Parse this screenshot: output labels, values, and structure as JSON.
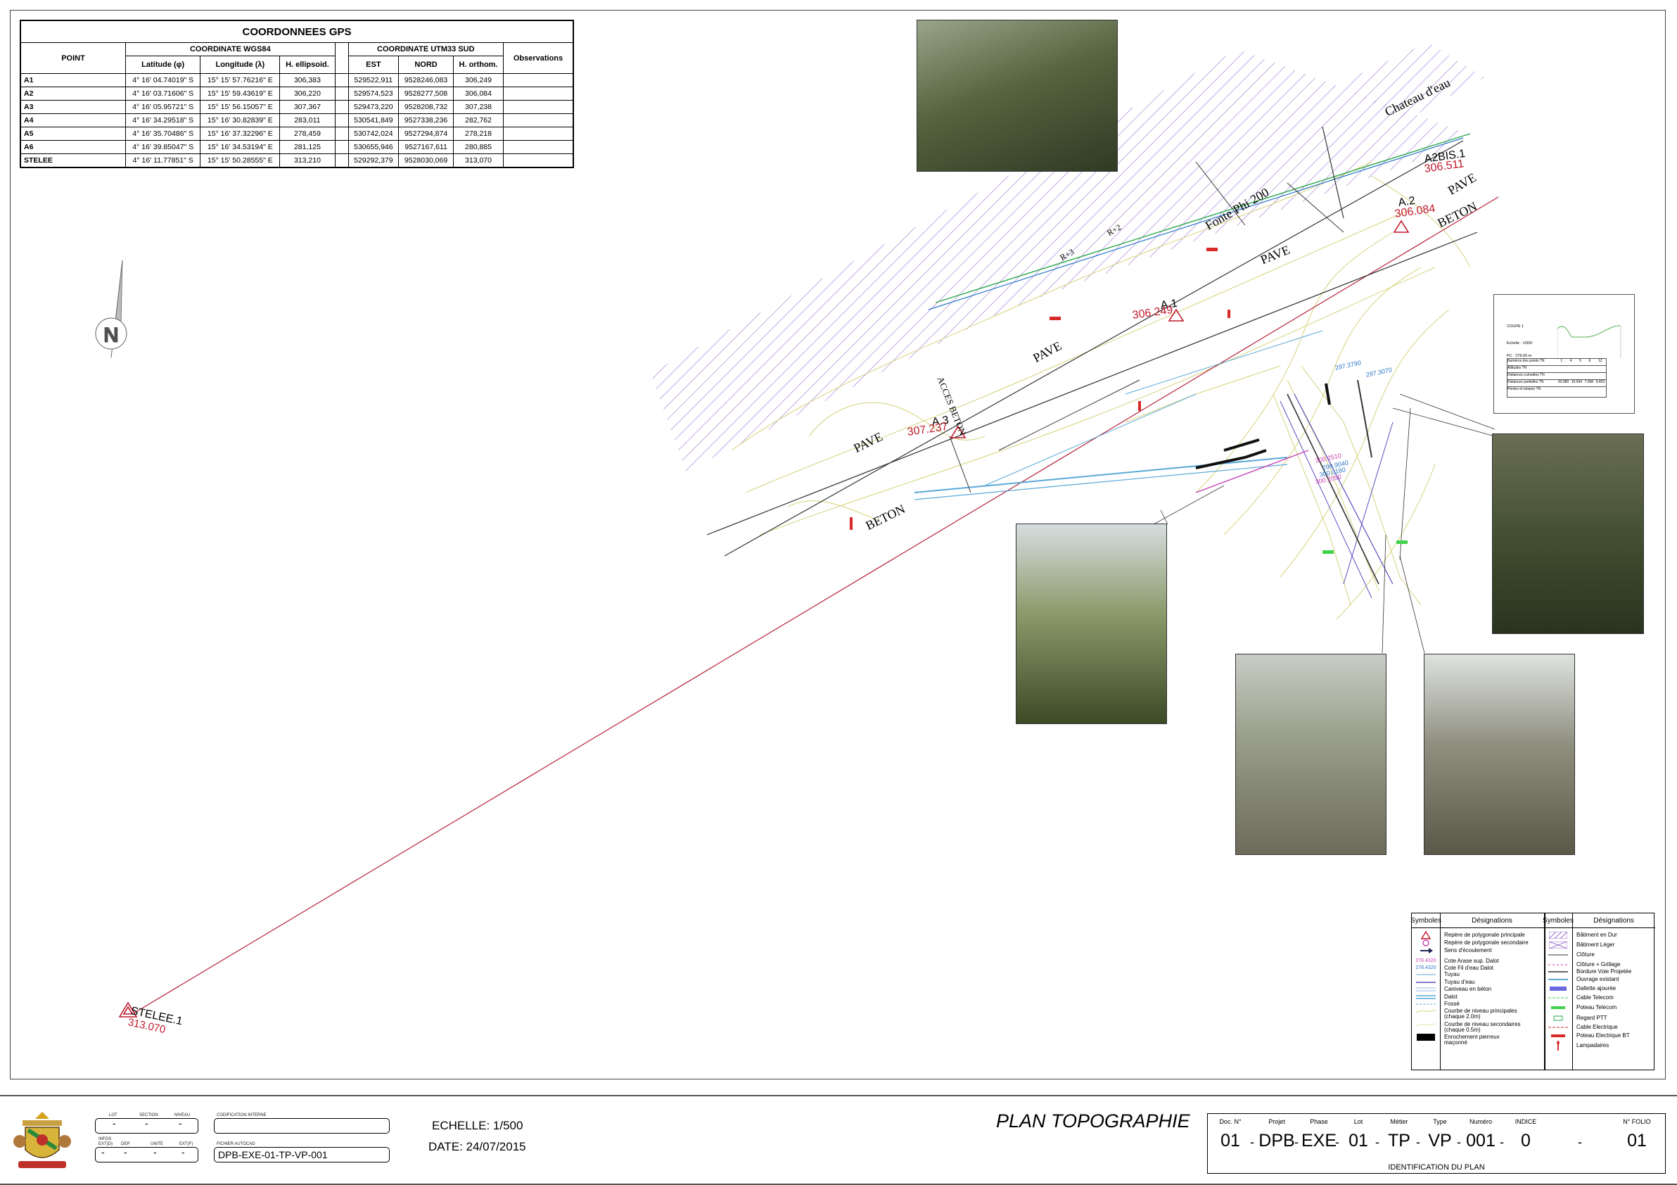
{
  "gps_table": {
    "title": "COORDONNEES GPS",
    "col_point": "POINT",
    "group_wgs": "COORDINATE WGS84",
    "group_utm": "COORDINATE UTM33 SUD",
    "col_obs": "Observations",
    "sub_lat": "Latitude (φ)",
    "sub_lon": "Longitude (λ)",
    "sub_hel": "H. ellipsoid.",
    "sub_est": "EST",
    "sub_nord": "NORD",
    "sub_hor": "H. orthom.",
    "rows": [
      {
        "point": "A1",
        "lat": "4° 16' 04.74019\" S",
        "lon": "15° 15' 57.76216\" E",
        "hel": "306,383",
        "est": "529522,911",
        "nord": "9528246,083",
        "hor": "306,249"
      },
      {
        "point": "A2",
        "lat": "4° 16' 03.71606\" S",
        "lon": "15° 15' 59.43619\" E",
        "hel": "306,220",
        "est": "529574,523",
        "nord": "9528277,508",
        "hor": "306,084"
      },
      {
        "point": "A3",
        "lat": "4° 16' 05.95721\" S",
        "lon": "15° 15' 56.15057\" E",
        "hel": "307,367",
        "est": "529473,220",
        "nord": "9528208,732",
        "hor": "307,238"
      },
      {
        "point": "A4",
        "lat": "4° 16' 34.29518\" S",
        "lon": "15° 16' 30.82839\" E",
        "hel": "283,011",
        "est": "530541,849",
        "nord": "9527338,236",
        "hor": "282,762"
      },
      {
        "point": "A5",
        "lat": "4° 16' 35.70486\" S",
        "lon": "15° 16' 37.32296\" E",
        "hel": "278,459",
        "est": "530742,024",
        "nord": "9527294,874",
        "hor": "278,218"
      },
      {
        "point": "A6",
        "lat": "4° 16' 39.85047\" S",
        "lon": "15° 16' 34.53194\" E",
        "hel": "281,125",
        "est": "530655,946",
        "nord": "9527167,611",
        "hor": "280,885"
      },
      {
        "point": "STELEE",
        "lat": "4° 16' 11.77851\" S",
        "lon": "15° 15' 50.28555\" E",
        "hel": "313,210",
        "est": "529292,379",
        "nord": "9528030,069",
        "hor": "313,070"
      }
    ]
  },
  "north": {
    "letter": "N"
  },
  "map_labels": {
    "chateau": "Chateau d'eau",
    "fonte": "Fonte Phi 200",
    "r3": "R+3",
    "r2": "R+2",
    "acces": "ACCES BETON",
    "pave": "PAVE",
    "beton": "BETON"
  },
  "points": {
    "a2bis_name": "A2BIS.1",
    "a2bis_elev": "306.511",
    "a2_name": "A.2",
    "a2_elev": "306.084",
    "a1_name": "A.1",
    "a1_elev": "306.249",
    "a3_name": "A.3",
    "a3_elev": "307.237",
    "stelee_name": "STELEE.1",
    "stelee_elev": "313.070",
    "lev1": "297.3790",
    "lev2": "297.3070",
    "lev3": "300.2510",
    "lev4": "299.9040",
    "lev5": "300.0180",
    "lev6": "300.2050"
  },
  "section": {
    "title": "COUPE 1",
    "scale": "Echelle : 1/500",
    "pc": "PC : 278.00 m",
    "row1": "Numéros des points TN",
    "row2": "Altitudes TN",
    "row3": "Distances cumulées TN",
    "row4": "Distances partielles TN",
    "row5": "Pentes et rampes TN",
    "v1": [
      "1",
      "4",
      "5",
      "6",
      "12"
    ],
    "v4": [
      "30.089",
      "10.094",
      "7.008",
      "9.403"
    ]
  },
  "legend": {
    "h_sym": "Symboles",
    "h_des": "Désignations",
    "left": [
      "Repère de polygonale principale",
      "Repère de polygonale secondaire",
      "Sens d'écoulement",
      "Cote Arase sup. Dalot",
      "Cote Fil d'eau Dalot",
      "Tuyau",
      "Tuyau d'eau",
      "Caniveau en béton",
      "Dalot",
      "Fossé",
      "Courbe de niveau principales",
      "(chaque 2.0m)",
      "Courbe de niveau secondaires",
      "(chaque 0.5m)",
      "Enrochement pierreux",
      "maçonné"
    ],
    "left_sym_a": "278.4320",
    "left_sym_b": "278.4320",
    "right": [
      "Bâtiment en Dur",
      "Bâtiment Léger",
      "Clôture",
      "Clôture + Grillage",
      "Bordure Voie Projetée",
      "Ouvrage existant",
      "Dallette ajourée",
      "Cable Telecom",
      "Poteau Telecom",
      "Regard PTT",
      "Cable Electrique",
      "Poteau Electrique BT",
      "Lampadaires"
    ]
  },
  "titleblock": {
    "f_lot": "LOT",
    "f_section": "SECTION",
    "f_niveau": "NIVEAU",
    "f_infos": "INFOS",
    "f_extd": "EXT(D)",
    "f_dep": "DEP",
    "f_unite": "UNITE",
    "f_extf": "EXT(F)",
    "dash": "-",
    "f_codif": "CODIFICATION INTERNE",
    "f_fichier": "FICHIER AUTOCAD",
    "fichier": "DPB-EXE-01-TP-VP-001",
    "echelle": "ECHELLE: 1/500",
    "date": "DATE: 24/07/2015",
    "plan_title": "PLAN TOPOGRAPHIE",
    "code_headers": [
      "Doc. N°",
      "Projet",
      "Phase",
      "Lot",
      "Métier",
      "Type",
      "Numéro",
      "INDICE",
      "N° FOLIO"
    ],
    "code_values": [
      "01",
      "DPB",
      "EXE",
      "01",
      "TP",
      "VP",
      "001",
      "0",
      "01"
    ],
    "ident": "IDENTIFICATION DU PLAN"
  }
}
